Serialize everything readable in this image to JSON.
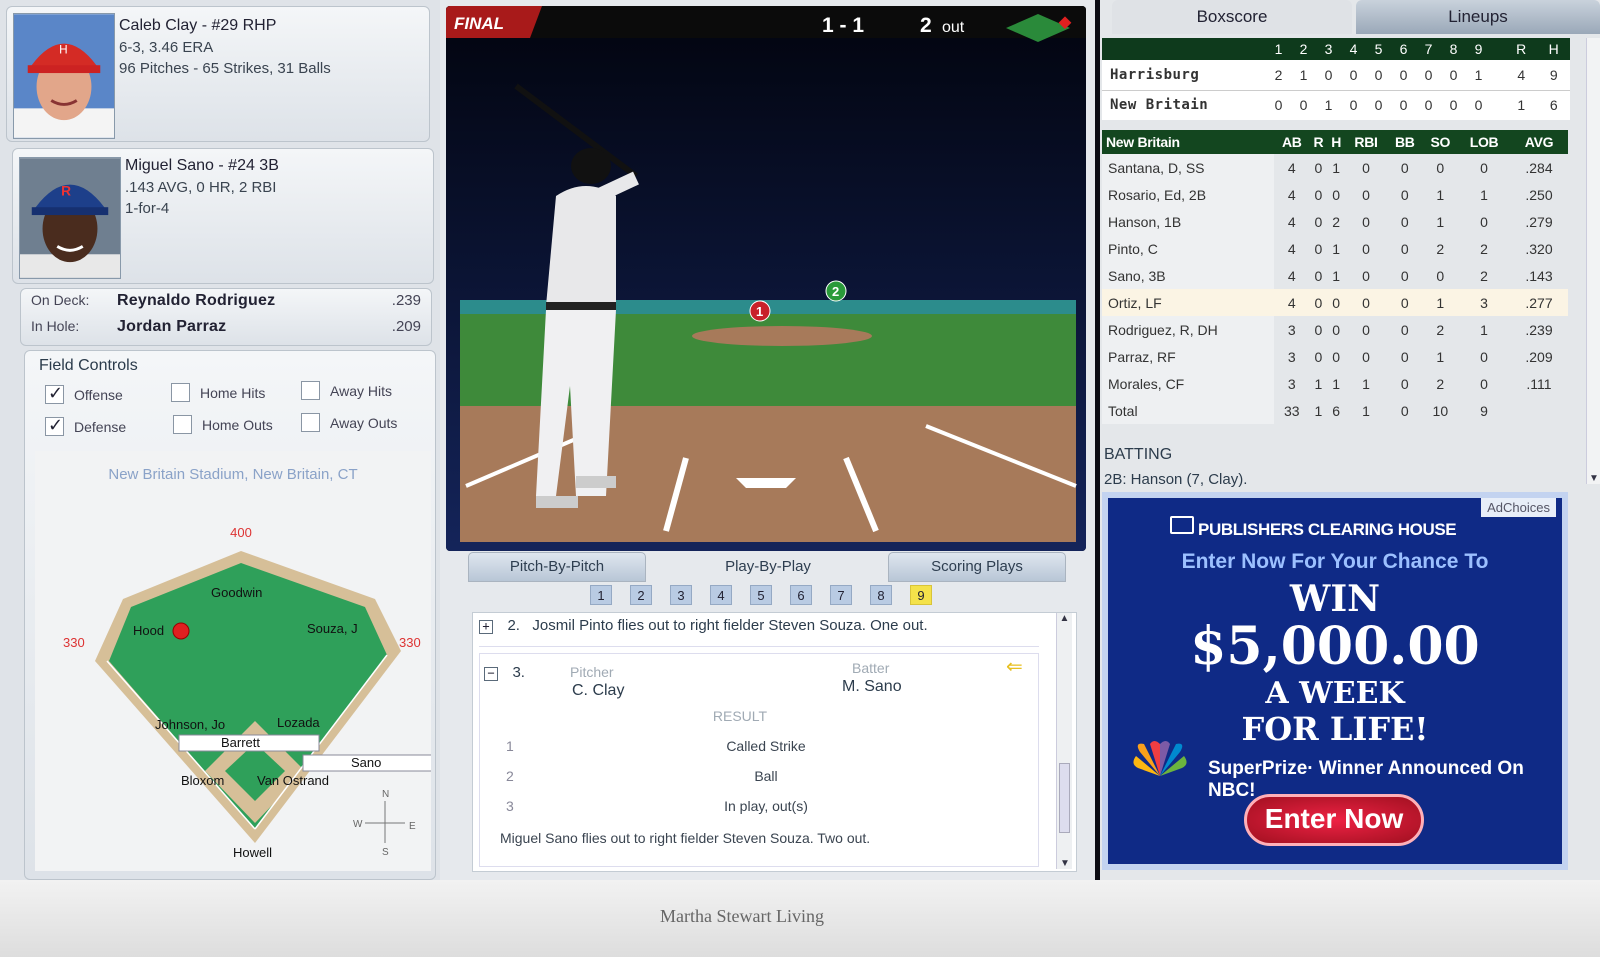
{
  "pitcher": {
    "name_line": "Caleb Clay - #29 RHP",
    "record": "6-3, 3.46 ERA",
    "pitches": "96 Pitches - 65 Strikes, 31 Balls"
  },
  "batter": {
    "name_line": "Miguel Sano - #24 3B",
    "stats": ".143 AVG, 0 HR, 2 RBI",
    "today": "1-for-4"
  },
  "on_deck": {
    "label": "On Deck:",
    "name": "Reynaldo Rodriguez",
    "avg": ".239"
  },
  "in_hole": {
    "label": "In Hole:",
    "name": "Jordan Parraz",
    "avg": ".209"
  },
  "field_controls": {
    "title": "Field Controls",
    "offense": "Offense",
    "defense": "Defense",
    "home_hits": "Home Hits",
    "away_hits": "Away Hits",
    "home_outs": "Home Outs",
    "away_outs": "Away Outs",
    "offense_checked": true,
    "defense_checked": true
  },
  "field": {
    "stadium": "New Britain Stadium, New Britain, CT",
    "dist_center": "400",
    "dist_left": "330",
    "dist_right": "330",
    "players": {
      "cf": "Goodwin",
      "lf": "Hood",
      "rf": "Souza, J",
      "ss": "Johnson, Jo",
      "second": "Lozada",
      "pitcher": "Barrett",
      "batter": "Sano",
      "third": "Bloxom",
      "first": "Van Ostrand",
      "catcher": "Howell"
    },
    "compass": {
      "n": "N",
      "s": "S",
      "e": "E",
      "w": "W"
    }
  },
  "game": {
    "status": "FINAL",
    "score": "1 - 1",
    "outs": "2",
    "outs_label": "out"
  },
  "center_tabs": [
    "Pitch-By-Pitch",
    "Play-By-Play",
    "Scoring Plays"
  ],
  "innings": [
    "1",
    "2",
    "3",
    "4",
    "5",
    "6",
    "7",
    "8",
    "9"
  ],
  "pbp": {
    "play2_num": "2.",
    "play2": "Josmil Pinto flies out to right fielder Steven Souza.  One out.",
    "play3_num": "3.",
    "pitcher_label": "Pitcher",
    "pitcher_name": "C. Clay",
    "batter_label": "Batter",
    "batter_name": "M. Sano",
    "result_label": "RESULT",
    "pitches": [
      {
        "n": "1",
        "result": "Called Strike"
      },
      {
        "n": "2",
        "result": "Ball"
      },
      {
        "n": "3",
        "result": "In play, out(s)"
      }
    ],
    "summary": "Miguel Sano flies out to right fielder Steven Souza.  Two out."
  },
  "right_tabs": [
    "Boxscore",
    "Lineups"
  ],
  "linescore": {
    "innings": [
      "1",
      "2",
      "3",
      "4",
      "5",
      "6",
      "7",
      "8",
      "9"
    ],
    "r_label": "R",
    "h_label": "H",
    "teams": [
      {
        "name": "Harrisburg",
        "runs": [
          "2",
          "1",
          "0",
          "0",
          "0",
          "0",
          "0",
          "0",
          "1"
        ],
        "r": "4",
        "h": "9"
      },
      {
        "name": "New Britain",
        "runs": [
          "0",
          "0",
          "1",
          "0",
          "0",
          "0",
          "0",
          "0",
          "0"
        ],
        "r": "1",
        "h": "6"
      }
    ]
  },
  "batting_table": {
    "team": "New Britain",
    "headers": [
      "AB",
      "R",
      "H",
      "RBI",
      "BB",
      "SO",
      "LOB",
      "AVG"
    ],
    "rows": [
      {
        "name": "Santana, D, SS",
        "ab": "4",
        "r": "0",
        "h": "1",
        "rbi": "0",
        "bb": "0",
        "so": "0",
        "lob": "0",
        "avg": ".284"
      },
      {
        "name": "Rosario, Ed, 2B",
        "ab": "4",
        "r": "0",
        "h": "0",
        "rbi": "0",
        "bb": "0",
        "so": "1",
        "lob": "1",
        "avg": ".250"
      },
      {
        "name": "Hanson, 1B",
        "ab": "4",
        "r": "0",
        "h": "2",
        "rbi": "0",
        "bb": "0",
        "so": "1",
        "lob": "0",
        "avg": ".279"
      },
      {
        "name": "Pinto, C",
        "ab": "4",
        "r": "0",
        "h": "1",
        "rbi": "0",
        "bb": "0",
        "so": "2",
        "lob": "2",
        "avg": ".320"
      },
      {
        "name": "Sano, 3B",
        "ab": "4",
        "r": "0",
        "h": "1",
        "rbi": "0",
        "bb": "0",
        "so": "0",
        "lob": "2",
        "avg": ".143"
      },
      {
        "name": "Ortiz, LF",
        "ab": "4",
        "r": "0",
        "h": "0",
        "rbi": "0",
        "bb": "0",
        "so": "1",
        "lob": "3",
        "avg": ".277"
      },
      {
        "name": "Rodriguez, R, DH",
        "ab": "3",
        "r": "0",
        "h": "0",
        "rbi": "0",
        "bb": "0",
        "so": "2",
        "lob": "1",
        "avg": ".239"
      },
      {
        "name": "Parraz, RF",
        "ab": "3",
        "r": "0",
        "h": "0",
        "rbi": "0",
        "bb": "0",
        "so": "1",
        "lob": "0",
        "avg": ".209"
      },
      {
        "name": "Morales, CF",
        "ab": "3",
        "r": "1",
        "h": "1",
        "rbi": "1",
        "bb": "0",
        "so": "2",
        "lob": "0",
        "avg": ".111"
      },
      {
        "name": "Total",
        "ab": "33",
        "r": "1",
        "h": "6",
        "rbi": "1",
        "bb": "0",
        "so": "10",
        "lob": "9",
        "avg": ""
      }
    ]
  },
  "batting_notes": {
    "title": "BATTING",
    "line": "2B: Hanson (7, Clay)."
  },
  "ad": {
    "choices": "AdChoices",
    "brand": "PUBLISHERS CLEARING HOUSE",
    "line1": "Enter  Now For Your Chance To",
    "win": "WIN",
    "amount": "$5,000.00",
    "week": "A WEEK",
    "life": "FOR LIFE!",
    "superprize": "SuperPrize·  Winner Announced On NBC!",
    "button": "Enter Now"
  },
  "footer": {
    "text": "Martha Stewart Living"
  },
  "colors": {
    "field_green": "#2fa05a",
    "dirt": "#d8c09a",
    "table_header": "#13461f",
    "ad_blue": "#0f2a86",
    "inning_current": "#f4e24a"
  }
}
